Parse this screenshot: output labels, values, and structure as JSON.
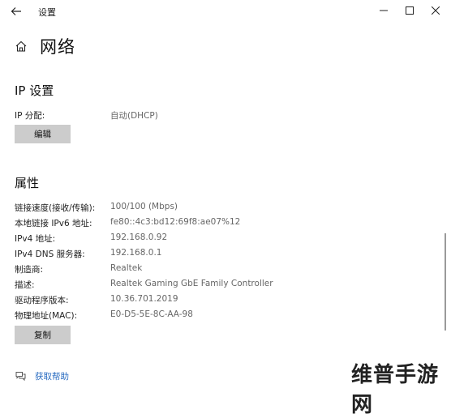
{
  "window": {
    "title": "设置",
    "back_icon": "back-arrow-icon",
    "controls": [
      "minimize-icon",
      "maximize-icon",
      "close-icon"
    ]
  },
  "page": {
    "title": "网络",
    "icon": "home-icon"
  },
  "ip_settings": {
    "heading": "IP 设置",
    "assignment_label": "IP 分配:",
    "assignment_value": "自动(DHCP)",
    "edit_button": "编辑"
  },
  "properties": {
    "heading": "属性",
    "rows": [
      {
        "label": "链接速度(接收/传输):",
        "value": "100/100 (Mbps)"
      },
      {
        "label": "本地链接 IPv6 地址:",
        "value": "fe80::4c3:bd12:69f8:ae07%12"
      },
      {
        "label": "IPv4 地址:",
        "value": "192.168.0.92"
      },
      {
        "label": "IPv4 DNS 服务器:",
        "value": "192.168.0.1"
      },
      {
        "label": "制造商:",
        "value": "Realtek"
      },
      {
        "label": "描述:",
        "value": "Realtek Gaming GbE Family Controller"
      },
      {
        "label": "驱动程序版本:",
        "value": "10.36.701.2019"
      },
      {
        "label": "物理地址(MAC):",
        "value": "E0-D5-5E-8C-AA-98"
      }
    ],
    "copy_button": "复制"
  },
  "help": {
    "label": "获取帮助",
    "icon": "help-chat-icon"
  },
  "watermark": {
    "text": "维普手游网"
  },
  "colors": {
    "accent": "#2a6cc1",
    "button_bg": "#cccccc",
    "muted_text": "#666666"
  }
}
